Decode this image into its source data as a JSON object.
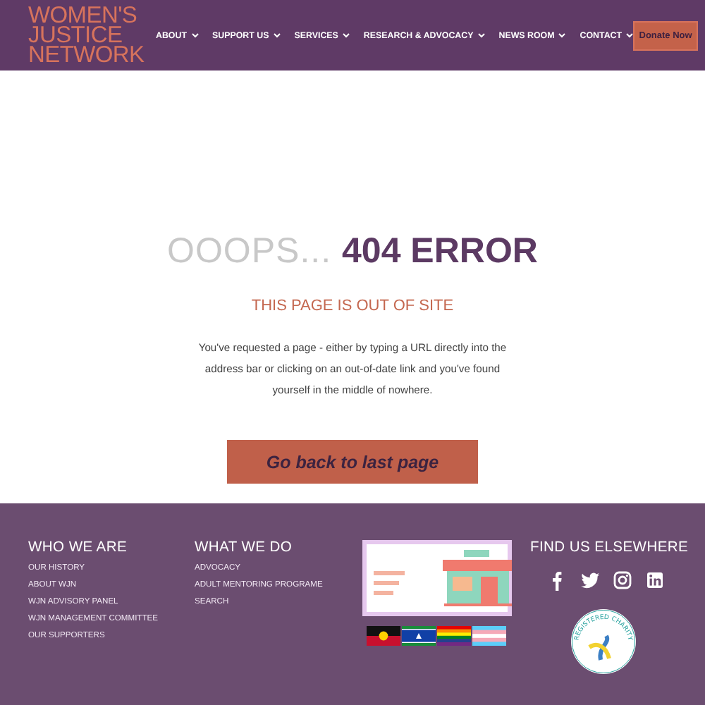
{
  "header": {
    "logo_lines": [
      "WOMEN'S",
      "JUSTICE",
      "NETWORK"
    ],
    "nav": [
      {
        "label": "ABOUT"
      },
      {
        "label": "SUPPORT US"
      },
      {
        "label": "SERVICES"
      },
      {
        "label": "RESEARCH & ADVOCACY"
      },
      {
        "label": "NEWS ROOM"
      },
      {
        "label": "CONTACT"
      }
    ],
    "donate_button": "Donate Now"
  },
  "error": {
    "title": "OOOPS... **404 ERROR**",
    "subtitle": "THIS PAGE IS OUT OF SITE",
    "message": "You've requested a page - either by typing a URL directly into the address bar or clicking on an out-of-date link and you've found yourself in the middle of nowhere.",
    "button": "Go back to last page"
  },
  "footer": {
    "columns": [
      {
        "heading": "WHO WE ARE",
        "links": [
          "OUR HISTORY",
          "ABOUT WJN",
          "WJN ADVISORY PANEL",
          "WJN MANAGEMENT COMMITTEE",
          "OUR SUPPORTERS"
        ]
      },
      {
        "heading": "WHAT WE DO",
        "links": [
          "ADVOCACY",
          "ADULT MENTORING PROGRAME",
          "SEARCH"
        ]
      }
    ],
    "social": {
      "heading": "FIND US ELSEWHERE"
    },
    "charity_badge": "REGISTERED CHARITY"
  }
}
